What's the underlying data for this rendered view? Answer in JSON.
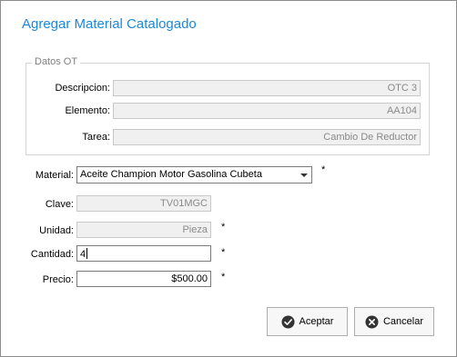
{
  "title": "Agregar Material Catalogado",
  "group": {
    "legend": "Datos OT",
    "descripcion": {
      "label": "Descripcion:",
      "value": "OTC 3"
    },
    "elemento": {
      "label": "Elemento:",
      "value": "AA104"
    },
    "tarea": {
      "label": "Tarea:",
      "value": "Cambio De Reductor"
    }
  },
  "material": {
    "label": "Material:",
    "value": "Aceite Champion Motor Gasolina Cubeta",
    "required": "*"
  },
  "clave": {
    "label": "Clave:",
    "value": "TV01MGC"
  },
  "unidad": {
    "label": "Unidad:",
    "value": "Pieza",
    "required": "*"
  },
  "cantidad": {
    "label": "Cantidad:",
    "value": "4",
    "required": "*"
  },
  "precio": {
    "label": "Precio:",
    "value": "$500.00",
    "required": "*"
  },
  "buttons": {
    "accept": {
      "label": "Aceptar",
      "icon": "check-circle-icon"
    },
    "cancel": {
      "label": "Cancelar",
      "icon": "x-circle-icon"
    }
  },
  "colors": {
    "title": "#1d88d4"
  }
}
